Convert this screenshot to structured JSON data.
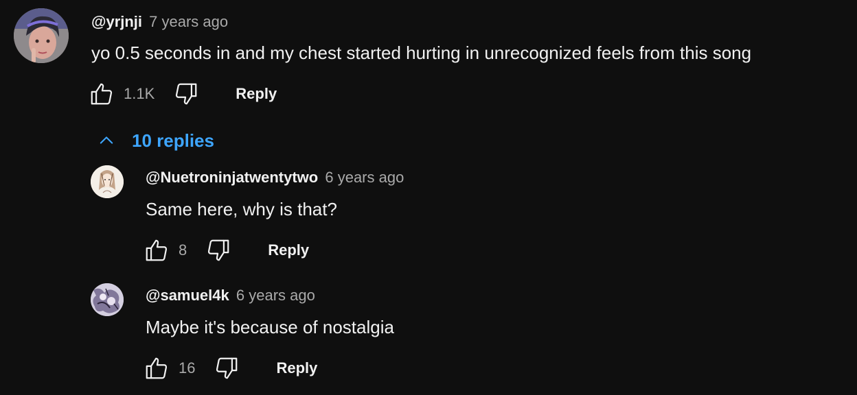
{
  "thread": {
    "main": {
      "author": "@yrjnji",
      "time": "7 years ago",
      "text": "yo 0.5 seconds in and my chest started hurting in unrecognized feels from this song",
      "likes": "1.1K",
      "reply_label": "Reply",
      "avatar_icon": "avatar-photo"
    },
    "replies_toggle": {
      "label": "10 replies",
      "icon": "chevron-up-icon",
      "color": "#3ea6ff"
    },
    "replies": [
      {
        "author": "@Nuetroninjatwentytwo",
        "time": "6 years ago",
        "text": "Same here, why is that?",
        "likes": "8",
        "reply_label": "Reply",
        "avatar_icon": "avatar-sketch"
      },
      {
        "author": "@samuel4k",
        "time": "6 years ago",
        "text": "Maybe it's because of nostalgia",
        "likes": "16",
        "reply_label": "Reply",
        "avatar_icon": "avatar-artwork"
      }
    ]
  },
  "colors": {
    "background": "#0f0f0f",
    "text": "#f1f1f1",
    "secondary": "#aaaaaa",
    "link": "#3ea6ff"
  }
}
